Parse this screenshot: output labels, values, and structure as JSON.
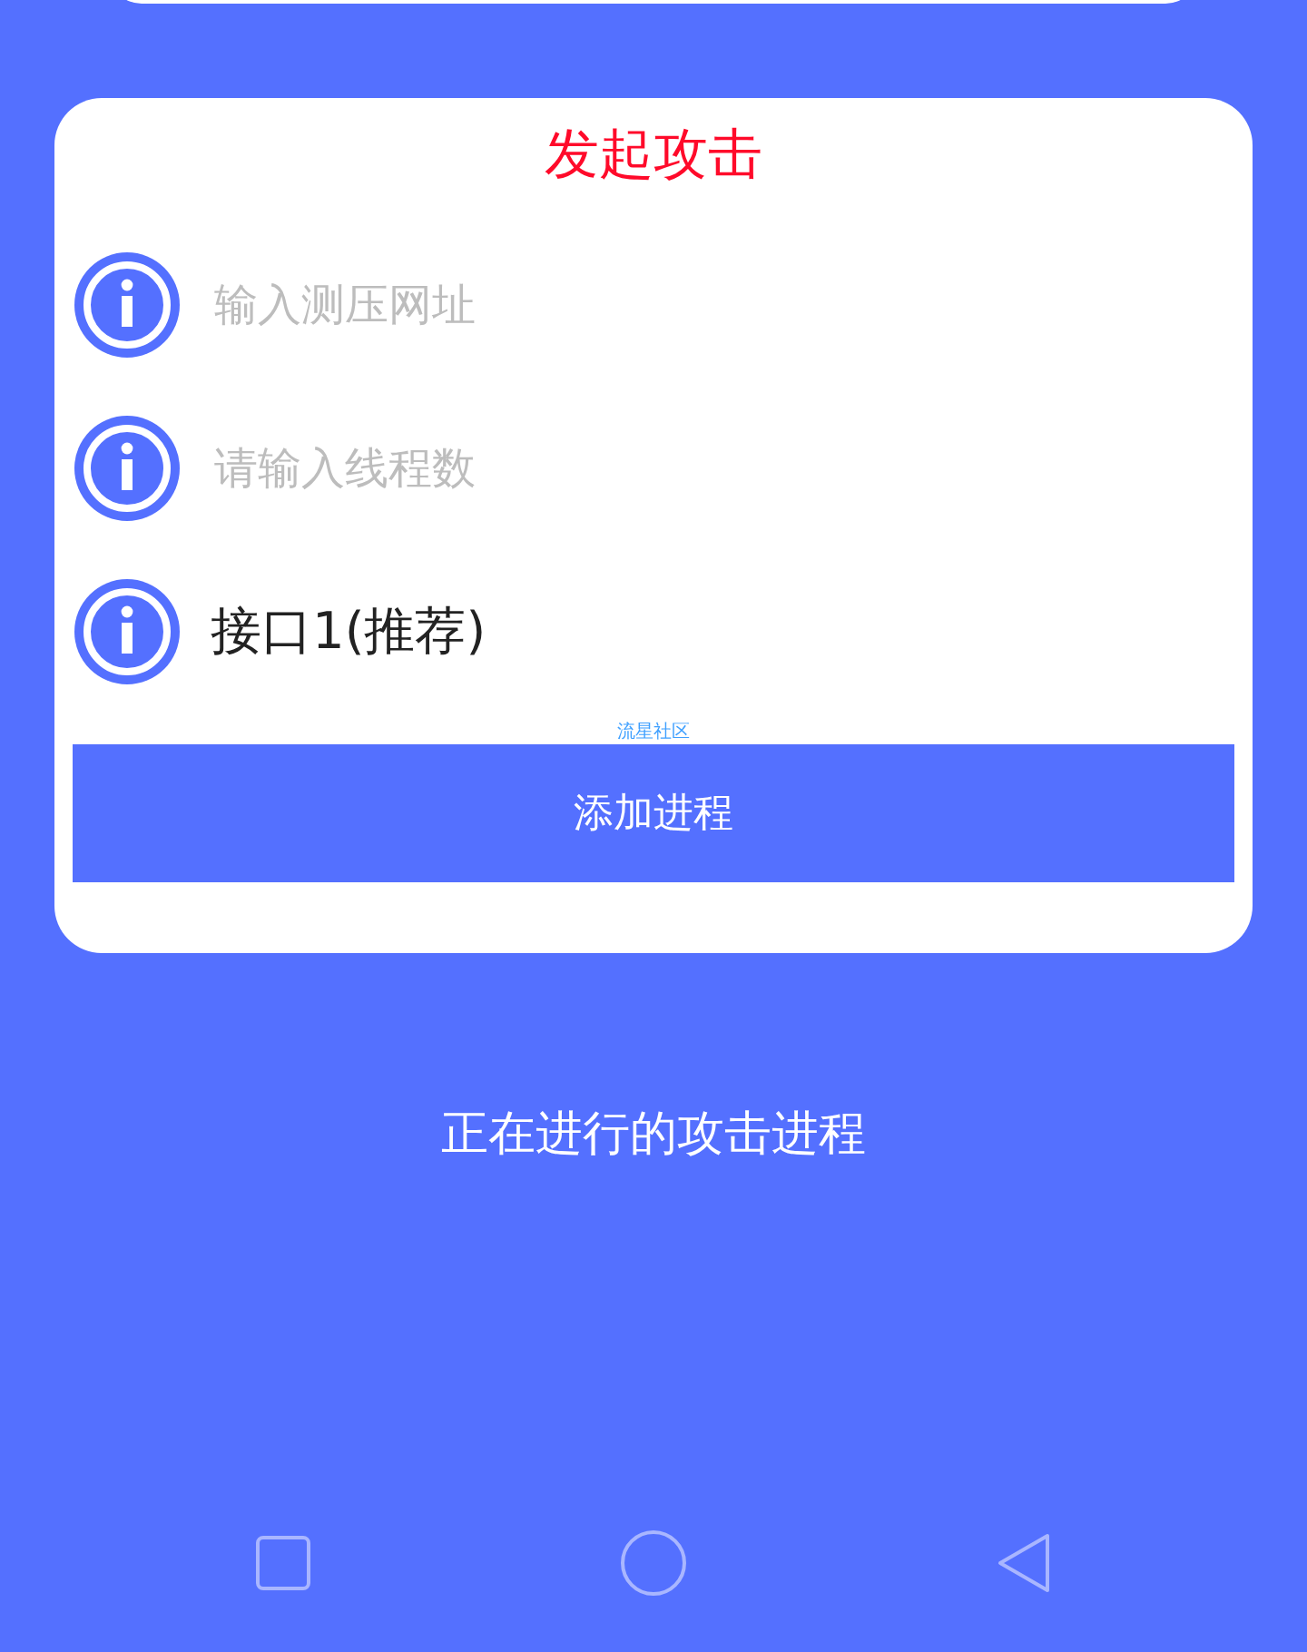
{
  "card": {
    "title": "发起攻击",
    "rows": [
      {
        "kind": "field",
        "placeholder": "输入测压网址"
      },
      {
        "kind": "field",
        "placeholder": "请输入线程数"
      },
      {
        "kind": "select",
        "value": "接口1(推荐)"
      }
    ],
    "community_label": "流星社区",
    "button": "添加进程"
  },
  "section_title": "正在进行的攻击进程"
}
